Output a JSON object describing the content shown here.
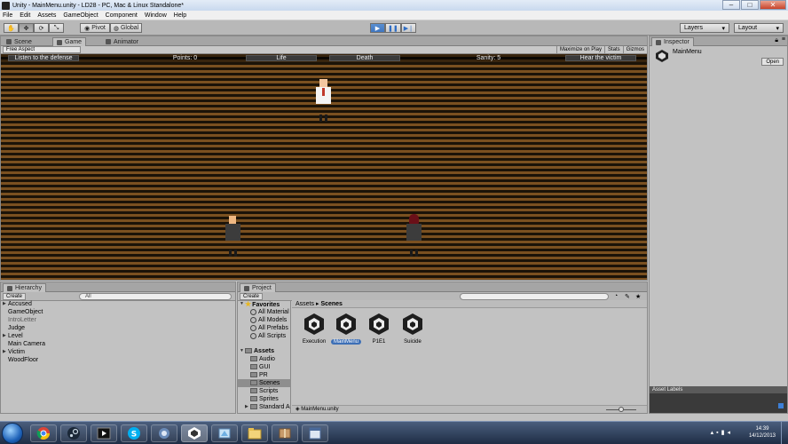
{
  "window": {
    "title": "Unity - MainMenu.unity - LD28 - PC, Mac & Linux Standalone*"
  },
  "menu": [
    "File",
    "Edit",
    "Assets",
    "GameObject",
    "Component",
    "Window",
    "Help"
  ],
  "toolbar": {
    "pivot_label": "Pivot",
    "global_label": "Global",
    "layers_label": "Layers",
    "layout_label": "Layout"
  },
  "scene_tabs": [
    "Scene",
    "Game",
    "Animator"
  ],
  "game_view": {
    "aspect": "Free Aspect",
    "options": [
      "Maximize on Play",
      "Stats",
      "Gizmos"
    ],
    "hud": {
      "listen": "Listen to the defense",
      "points": "Points: 0",
      "life": "Life",
      "death": "Death",
      "sanity": "Sanity: 5",
      "hear": "Hear the victim"
    }
  },
  "hierarchy": {
    "tab": "Hierarchy",
    "create": "Create",
    "search_placeholder": "All",
    "items": [
      "Accused",
      "GameObject",
      "IntroLetter",
      "Judge",
      "Level",
      "Main Camera",
      "Victim",
      "WoodFloor"
    ]
  },
  "project": {
    "tab": "Project",
    "create": "Create",
    "favorites_label": "Favorites",
    "favorites": [
      "All Material",
      "All Models",
      "All Prefabs",
      "All Scripts"
    ],
    "assets_label": "Assets",
    "folders": [
      "Audio",
      "GUI",
      "PR",
      "Scenes",
      "Scripts",
      "Sprites",
      "Standard A"
    ],
    "breadcrumb_root": "Assets",
    "breadcrumb_current": "Scenes",
    "scenes": [
      "Execution",
      "MainMenu",
      "P1E1",
      "Suicide"
    ],
    "selected_file": "MainMenu.unity"
  },
  "inspector": {
    "tab": "Inspector",
    "object_name": "MainMenu",
    "open_label": "Open",
    "asset_labels": "Asset Labels"
  },
  "taskbar": {
    "time": "14:39",
    "date": "14/12/2013"
  },
  "colors": {
    "accent_blue": "#3d6fb6",
    "floor_brown": "#7a5020"
  }
}
